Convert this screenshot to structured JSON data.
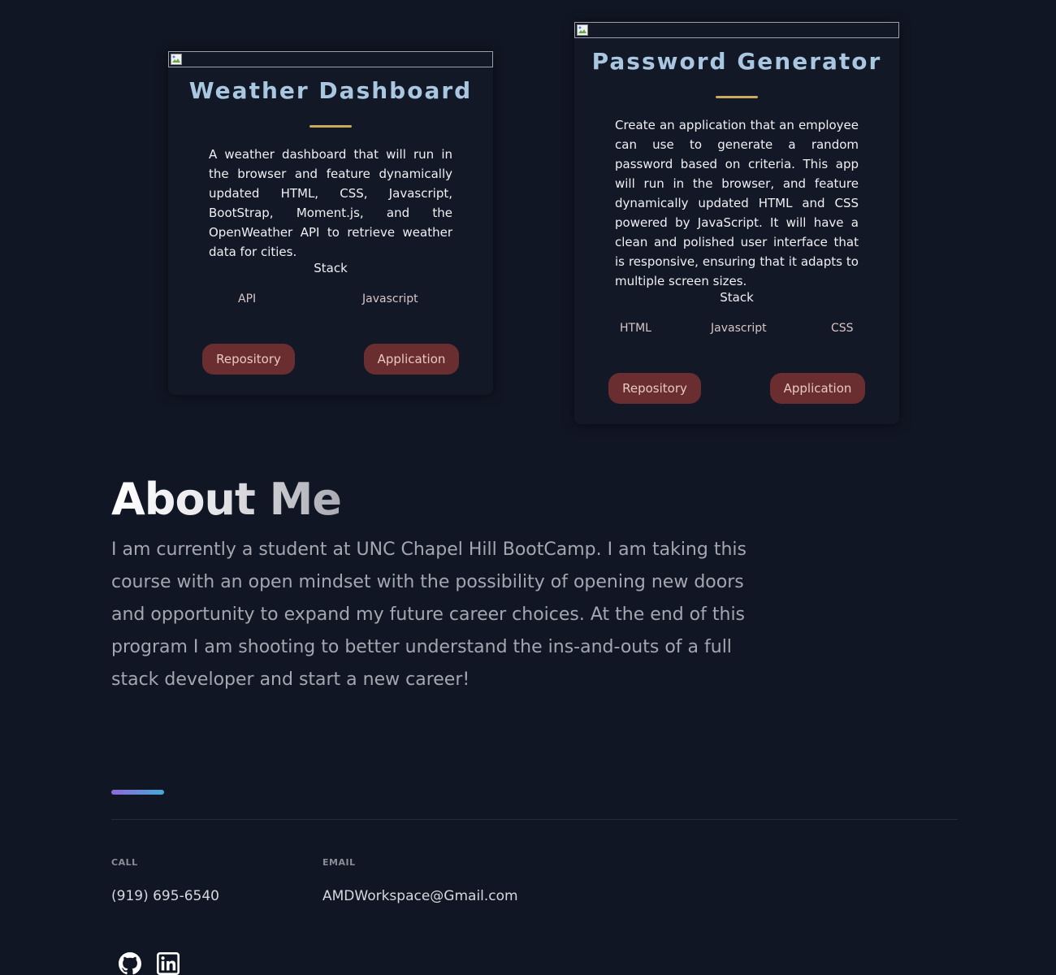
{
  "projects": [
    {
      "title": "Weather Dashboard",
      "description": "A weather dashboard that will run in the browser and feature dynamically updated HTML, CSS, Javascript, BootStrap, Moment.js, and the OpenWeather API to retrieve weather data for cities.",
      "stack_label": "Stack",
      "stack": [
        "API",
        "Javascript"
      ],
      "repo_label": "Repository",
      "app_label": "Application"
    },
    {
      "title": "Password Generator",
      "description": "Create an application that an employee can use to generate a random password based on criteria. This app will run in the browser, and feature dynamically updated HTML and CSS powered by JavaScript. It will have a clean and polished user interface that is responsive, ensuring that it adapts to multiple screen sizes.",
      "stack_label": "Stack",
      "stack": [
        "HTML",
        "Javascript",
        "CSS"
      ],
      "repo_label": "Repository",
      "app_label": "Application"
    }
  ],
  "about": {
    "title": "About Me",
    "text": "I am currently a student at UNC Chapel Hill BootCamp. I am taking this course with an open mindset with the possibility of opening new doors and opportunity to expand my future career choices. At the end of this program I am shooting to better understand the ins-and-outs of a full stack developer and start a new career!"
  },
  "contact": {
    "call_label": "CALL",
    "phone": "(919) 695-6540",
    "email_label": "EMAIL",
    "email": "AMDWorkspace@Gmail.com"
  },
  "social": {
    "icons": [
      "github-icon",
      "linkedin-icon"
    ]
  },
  "colors": {
    "background": "#111624",
    "card": "#131826",
    "card_title": "#a9c7e0",
    "title_rule": "#c9a95b",
    "button": "#6b2e30",
    "accent_gradient": [
      "#8d6ad8",
      "#45a9d8"
    ]
  }
}
